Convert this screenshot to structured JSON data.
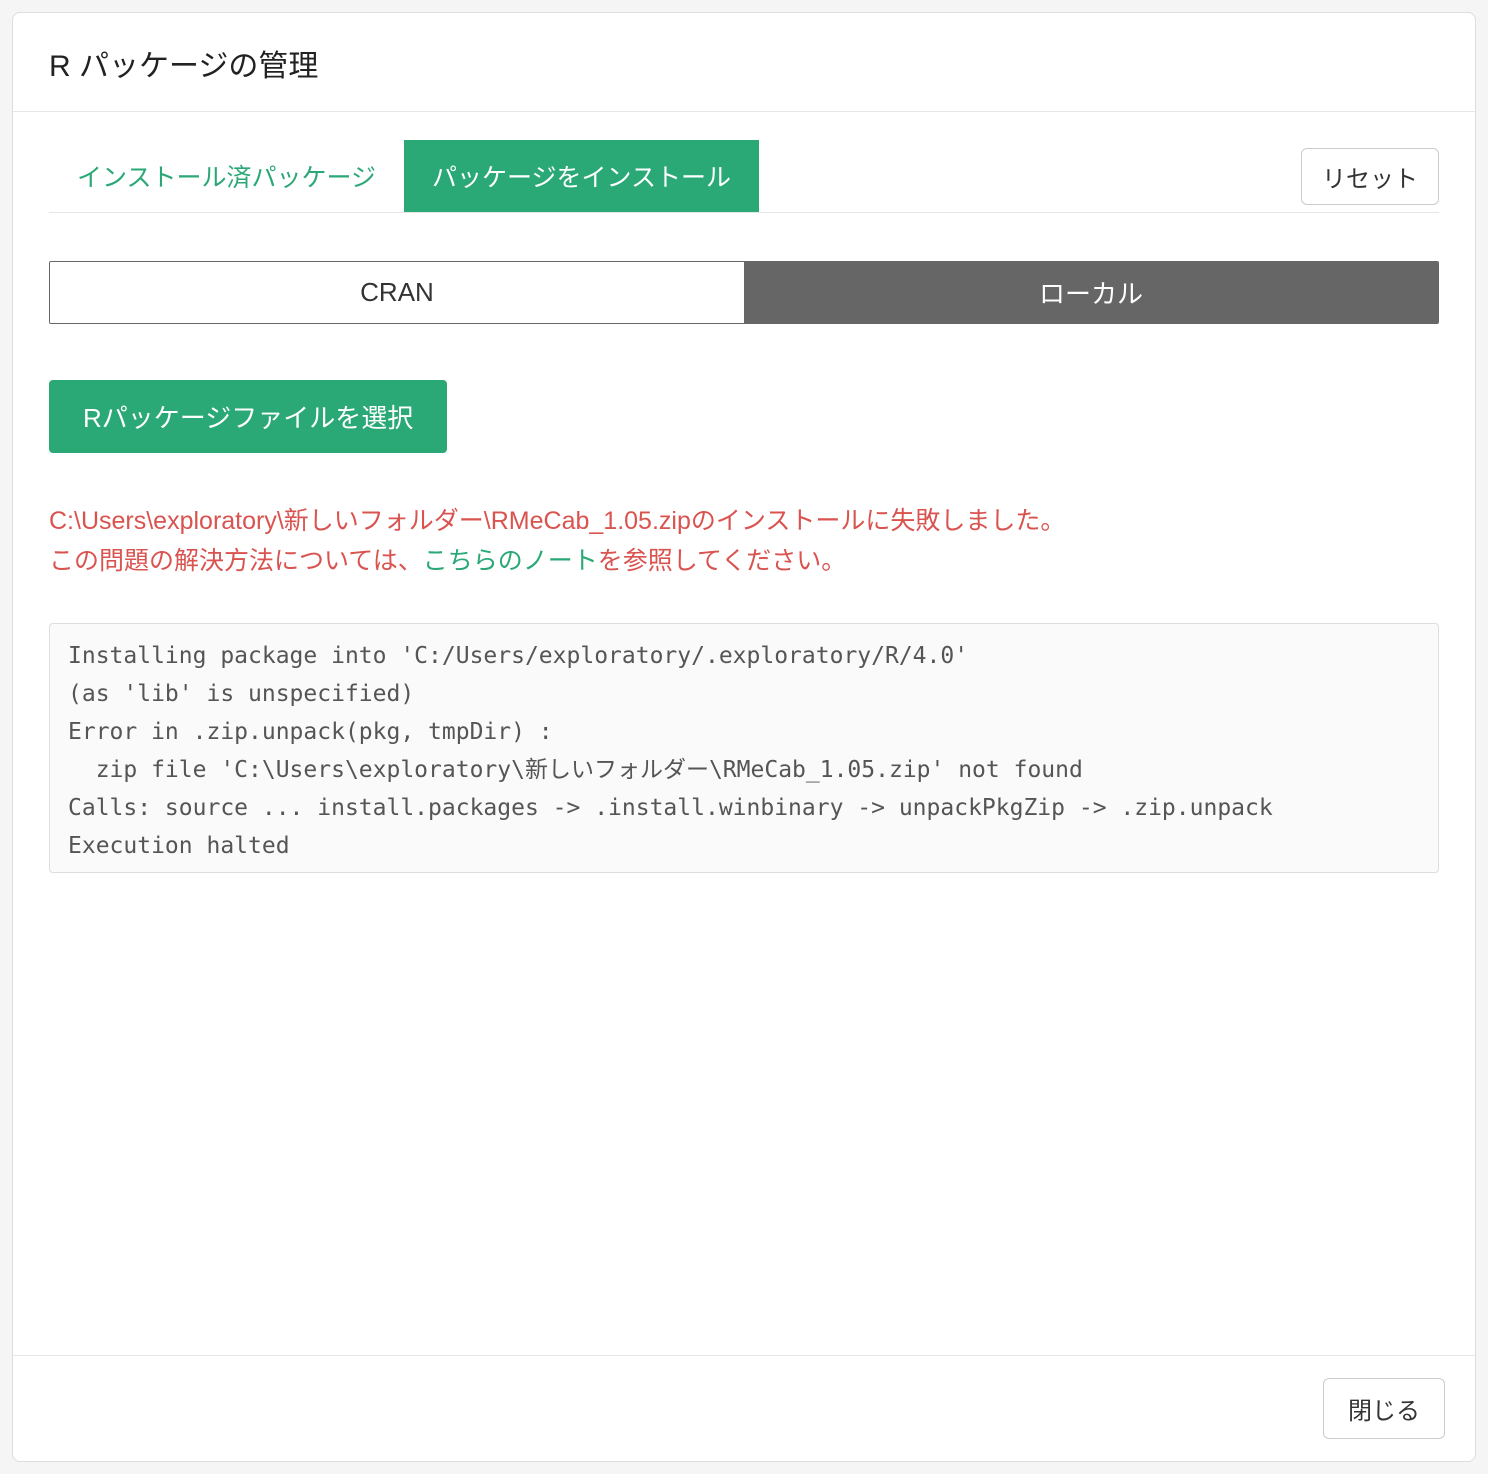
{
  "modal": {
    "title": "R パッケージの管理",
    "close_label": "閉じる"
  },
  "tabs": {
    "installed": "インストール済パッケージ",
    "install": "パッケージをインストール",
    "reset": "リセット"
  },
  "source": {
    "cran": "CRAN",
    "local": "ローカル"
  },
  "actions": {
    "select_file": "Rパッケージファイルを選択"
  },
  "error": {
    "line1": "C:\\Users\\exploratory\\新しいフォルダー\\RMeCab_1.05.zipのインストールに失敗しました。",
    "line2_before": "この問題の解決方法については、",
    "line2_link": "こちらのノート",
    "line2_after": "を参照してください。"
  },
  "log": "Installing package into 'C:/Users/exploratory/.exploratory/R/4.0'\n(as 'lib' is unspecified)\nError in .zip.unpack(pkg, tmpDir) : \n  zip file 'C:\\Users\\exploratory\\新しいフォルダー\\RMeCab_1.05.zip' not found\nCalls: source ... install.packages -> .install.winbinary -> unpackPkgZip -> .zip.unpack\nExecution halted"
}
